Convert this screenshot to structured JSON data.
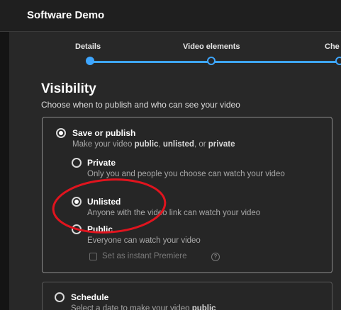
{
  "header": {
    "title": "Software Demo"
  },
  "stepper": {
    "steps": [
      {
        "label": "Details"
      },
      {
        "label": "Video elements"
      },
      {
        "label": "Che"
      }
    ]
  },
  "visibility": {
    "heading": "Visibility",
    "subheading": "Choose when to publish and who can see your video"
  },
  "save_or_publish": {
    "title": "Save or publish",
    "desc_prefix": "Make your video ",
    "desc_public": "public",
    "desc_sep1": ", ",
    "desc_unlisted": "unlisted",
    "desc_sep2": ", or ",
    "desc_private": "private",
    "selected": true
  },
  "options": [
    {
      "title": "Private",
      "desc": "Only you and people you choose can watch your video",
      "selected": false
    },
    {
      "title": "Unlisted",
      "desc": "Anyone with the video link can watch your video",
      "selected": true
    },
    {
      "title": "Public",
      "desc": "Everyone can watch your video",
      "selected": false
    }
  ],
  "premiere": {
    "label": "Set as instant Premiere",
    "checked": false
  },
  "schedule": {
    "title": "Schedule",
    "desc_prefix": "Select a date to make your video ",
    "desc_bold": "public"
  },
  "colors": {
    "accent": "#3ea6ff",
    "background": "#282828",
    "annotation_circle": "#e0141e"
  }
}
